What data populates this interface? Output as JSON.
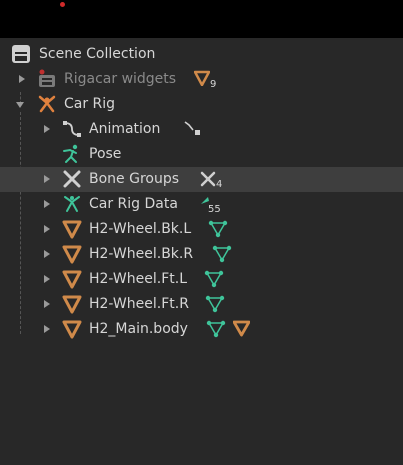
{
  "colors": {
    "background": "#282828",
    "selected_row": "#3e3e3e",
    "mesh_orange": "#d08a4a",
    "armature_orange": "#e0813e",
    "teal": "#3fc49a",
    "text": "#d6d6d6",
    "dim_text": "#8a8a8a"
  },
  "outliner": {
    "scene_collection": {
      "label": "Scene Collection",
      "icon": "scene-collection-icon"
    },
    "rows": [
      {
        "label": "Rigacar widgets",
        "icon": "collection-icon",
        "expanded": false,
        "dimmed": true,
        "badge_icon": "mesh-icon",
        "badge_count": "9"
      },
      {
        "label": "Car Rig",
        "icon": "armature-object-icon",
        "expanded": true
      },
      {
        "label": "Animation",
        "icon": "animation-icon",
        "expanded": false,
        "badge_icon": "action-icon"
      },
      {
        "label": "Pose",
        "icon": "pose-icon"
      },
      {
        "label": "Bone Groups",
        "icon": "bone-groups-icon",
        "expanded": false,
        "selected": true,
        "badge_icon": "bone-groups-icon",
        "badge_count": "4"
      },
      {
        "label": "Car Rig Data",
        "icon": "armature-data-icon",
        "expanded": false,
        "badge_icon": "bone-icon",
        "badge_count": "55"
      },
      {
        "label": "H2-Wheel.Bk.L",
        "icon": "mesh-object-icon",
        "expanded": false,
        "badge_icon": "mesh-data-icon"
      },
      {
        "label": "H2-Wheel.Bk.R",
        "icon": "mesh-object-icon",
        "expanded": false,
        "badge_icon": "mesh-data-icon"
      },
      {
        "label": "H2-Wheel.Ft.L",
        "icon": "mesh-object-icon",
        "expanded": false,
        "badge_icon": "mesh-data-icon"
      },
      {
        "label": "H2-Wheel.Ft.R",
        "icon": "mesh-object-icon",
        "expanded": false,
        "badge_icon": "mesh-data-icon"
      },
      {
        "label": "H2_Main.body",
        "icon": "mesh-object-icon",
        "expanded": false,
        "badge_icon": "mesh-data-icon",
        "badge_icon_2": "mesh-icon"
      }
    ]
  }
}
